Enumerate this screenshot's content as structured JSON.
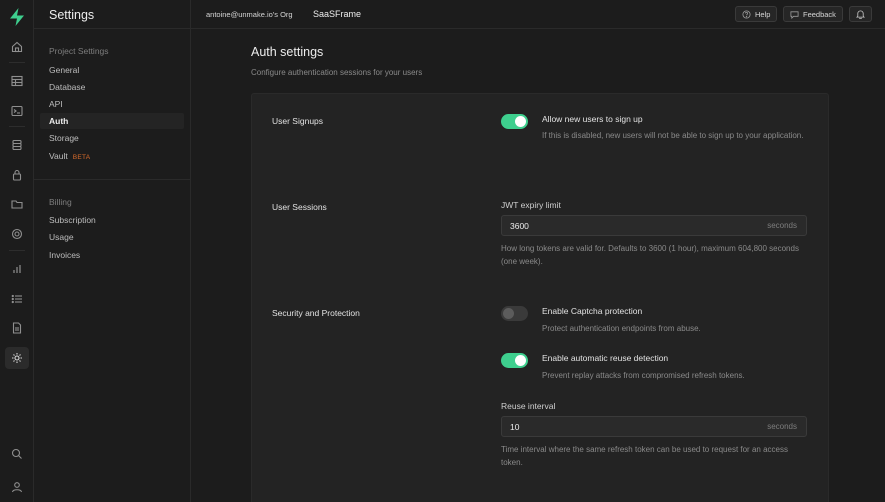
{
  "sidebar": {
    "title": "Settings",
    "project_group": "Project Settings",
    "project_items": [
      {
        "label": "General"
      },
      {
        "label": "Database"
      },
      {
        "label": "API"
      },
      {
        "label": "Auth"
      },
      {
        "label": "Storage"
      },
      {
        "label": "Vault",
        "badge": "BETA"
      }
    ],
    "billing_group": "Billing",
    "billing_items": [
      {
        "label": "Subscription"
      },
      {
        "label": "Usage"
      },
      {
        "label": "Invoices"
      }
    ]
  },
  "topbar": {
    "org": "antoine@unmake.io's Org",
    "project": "SaaSFrame",
    "help": "Help",
    "feedback": "Feedback"
  },
  "main": {
    "title": "Auth settings",
    "subtitle": "Configure authentication sessions for your users",
    "signups": {
      "section": "User Signups",
      "label": "Allow new users to sign up",
      "desc": "If this is disabled, new users will not be able to sign up to your application.",
      "enabled": true
    },
    "sessions": {
      "section": "User Sessions",
      "field_label": "JWT expiry limit",
      "value": "3600",
      "unit": "seconds",
      "help": "How long tokens are valid for. Defaults to 3600 (1 hour), maximum 604,800 seconds (one week)."
    },
    "security": {
      "section": "Security and Protection",
      "captcha_label": "Enable Captcha protection",
      "captcha_desc": "Protect authentication endpoints from abuse.",
      "captcha_enabled": false,
      "reuse_label": "Enable automatic reuse detection",
      "reuse_desc": "Prevent replay attacks from compromised refresh tokens.",
      "reuse_enabled": true,
      "interval_label": "Reuse interval",
      "interval_value": "10",
      "interval_unit": "seconds",
      "interval_help": "Time interval where the same refresh token can be used to request for an access token."
    }
  },
  "colors": {
    "accent": "#3ecf8e",
    "background": "#1c1c1c",
    "panel": "#232323",
    "beta_badge": "#d96b2b"
  },
  "icons": [
    "supabase-logo",
    "home-icon",
    "table-icon",
    "terminal-icon",
    "database-icon",
    "lock-icon",
    "folder-icon",
    "functions-icon",
    "chart-icon",
    "logs-icon",
    "document-icon",
    "gear-icon",
    "search-icon",
    "user-icon",
    "help-icon",
    "chat-icon",
    "bell-icon"
  ]
}
